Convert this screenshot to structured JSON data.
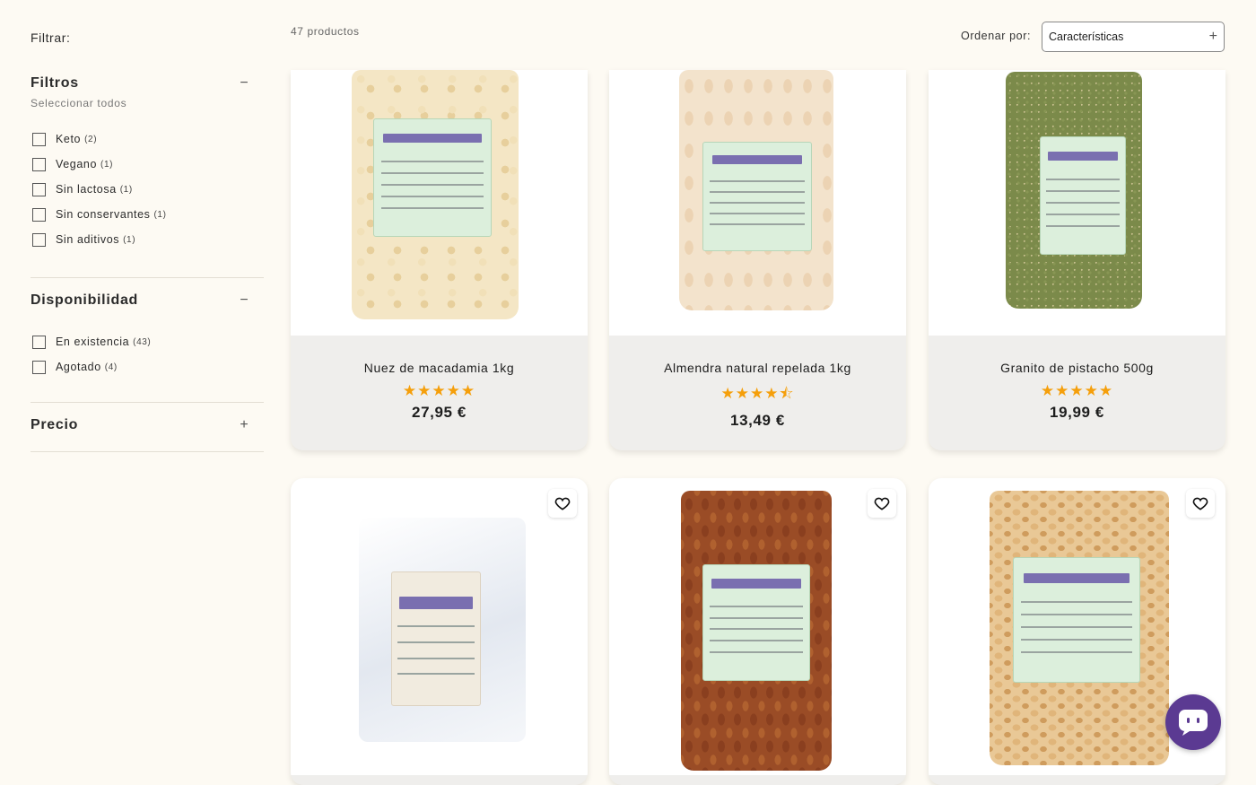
{
  "sidebar": {
    "filter_title": "Filtrar:",
    "filtros": {
      "title": "Filtros",
      "toggle": "−",
      "select_all": "Seleccionar todos",
      "options": [
        {
          "label": "Keto",
          "count": "(2)"
        },
        {
          "label": "Vegano",
          "count": "(1)"
        },
        {
          "label": "Sin lactosa",
          "count": "(1)"
        },
        {
          "label": "Sin conservantes",
          "count": "(1)"
        },
        {
          "label": "Sin aditivos",
          "count": "(1)"
        }
      ]
    },
    "disponibilidad": {
      "title": "Disponibilidad",
      "toggle": "−",
      "options": [
        {
          "label": "En existencia",
          "count": "(43)"
        },
        {
          "label": "Agotado",
          "count": "(4)"
        }
      ]
    },
    "precio": {
      "title": "Precio",
      "toggle": "+"
    }
  },
  "toolbar": {
    "product_count": "47 productos",
    "sort_label": "Ordenar por:",
    "sort_value": "Características",
    "sort_icon": "plus-icon"
  },
  "products": [
    {
      "name": "Nuez de macadamia 1kg",
      "rating": 5,
      "stars": "★★★★★",
      "price": "27,95 €"
    },
    {
      "name": "Almendra natural repelada 1kg",
      "rating": 4.5,
      "stars": "★★★★⯪",
      "price": "13,49 €"
    },
    {
      "name": "Granito de pistacho 500g",
      "rating": 5,
      "stars": "★★★★★",
      "price": "19,99 €"
    },
    {
      "name": "",
      "stars": "",
      "price": ""
    },
    {
      "name": "",
      "stars": "",
      "price": ""
    },
    {
      "name": "",
      "stars": "",
      "price": ""
    }
  ],
  "colors": {
    "background": "#fdfaf3",
    "star": "#f59f0b",
    "chat_button": "#5b3a92"
  },
  "icons": {
    "wishlist": "heart-icon",
    "chat": "chat-icon"
  }
}
